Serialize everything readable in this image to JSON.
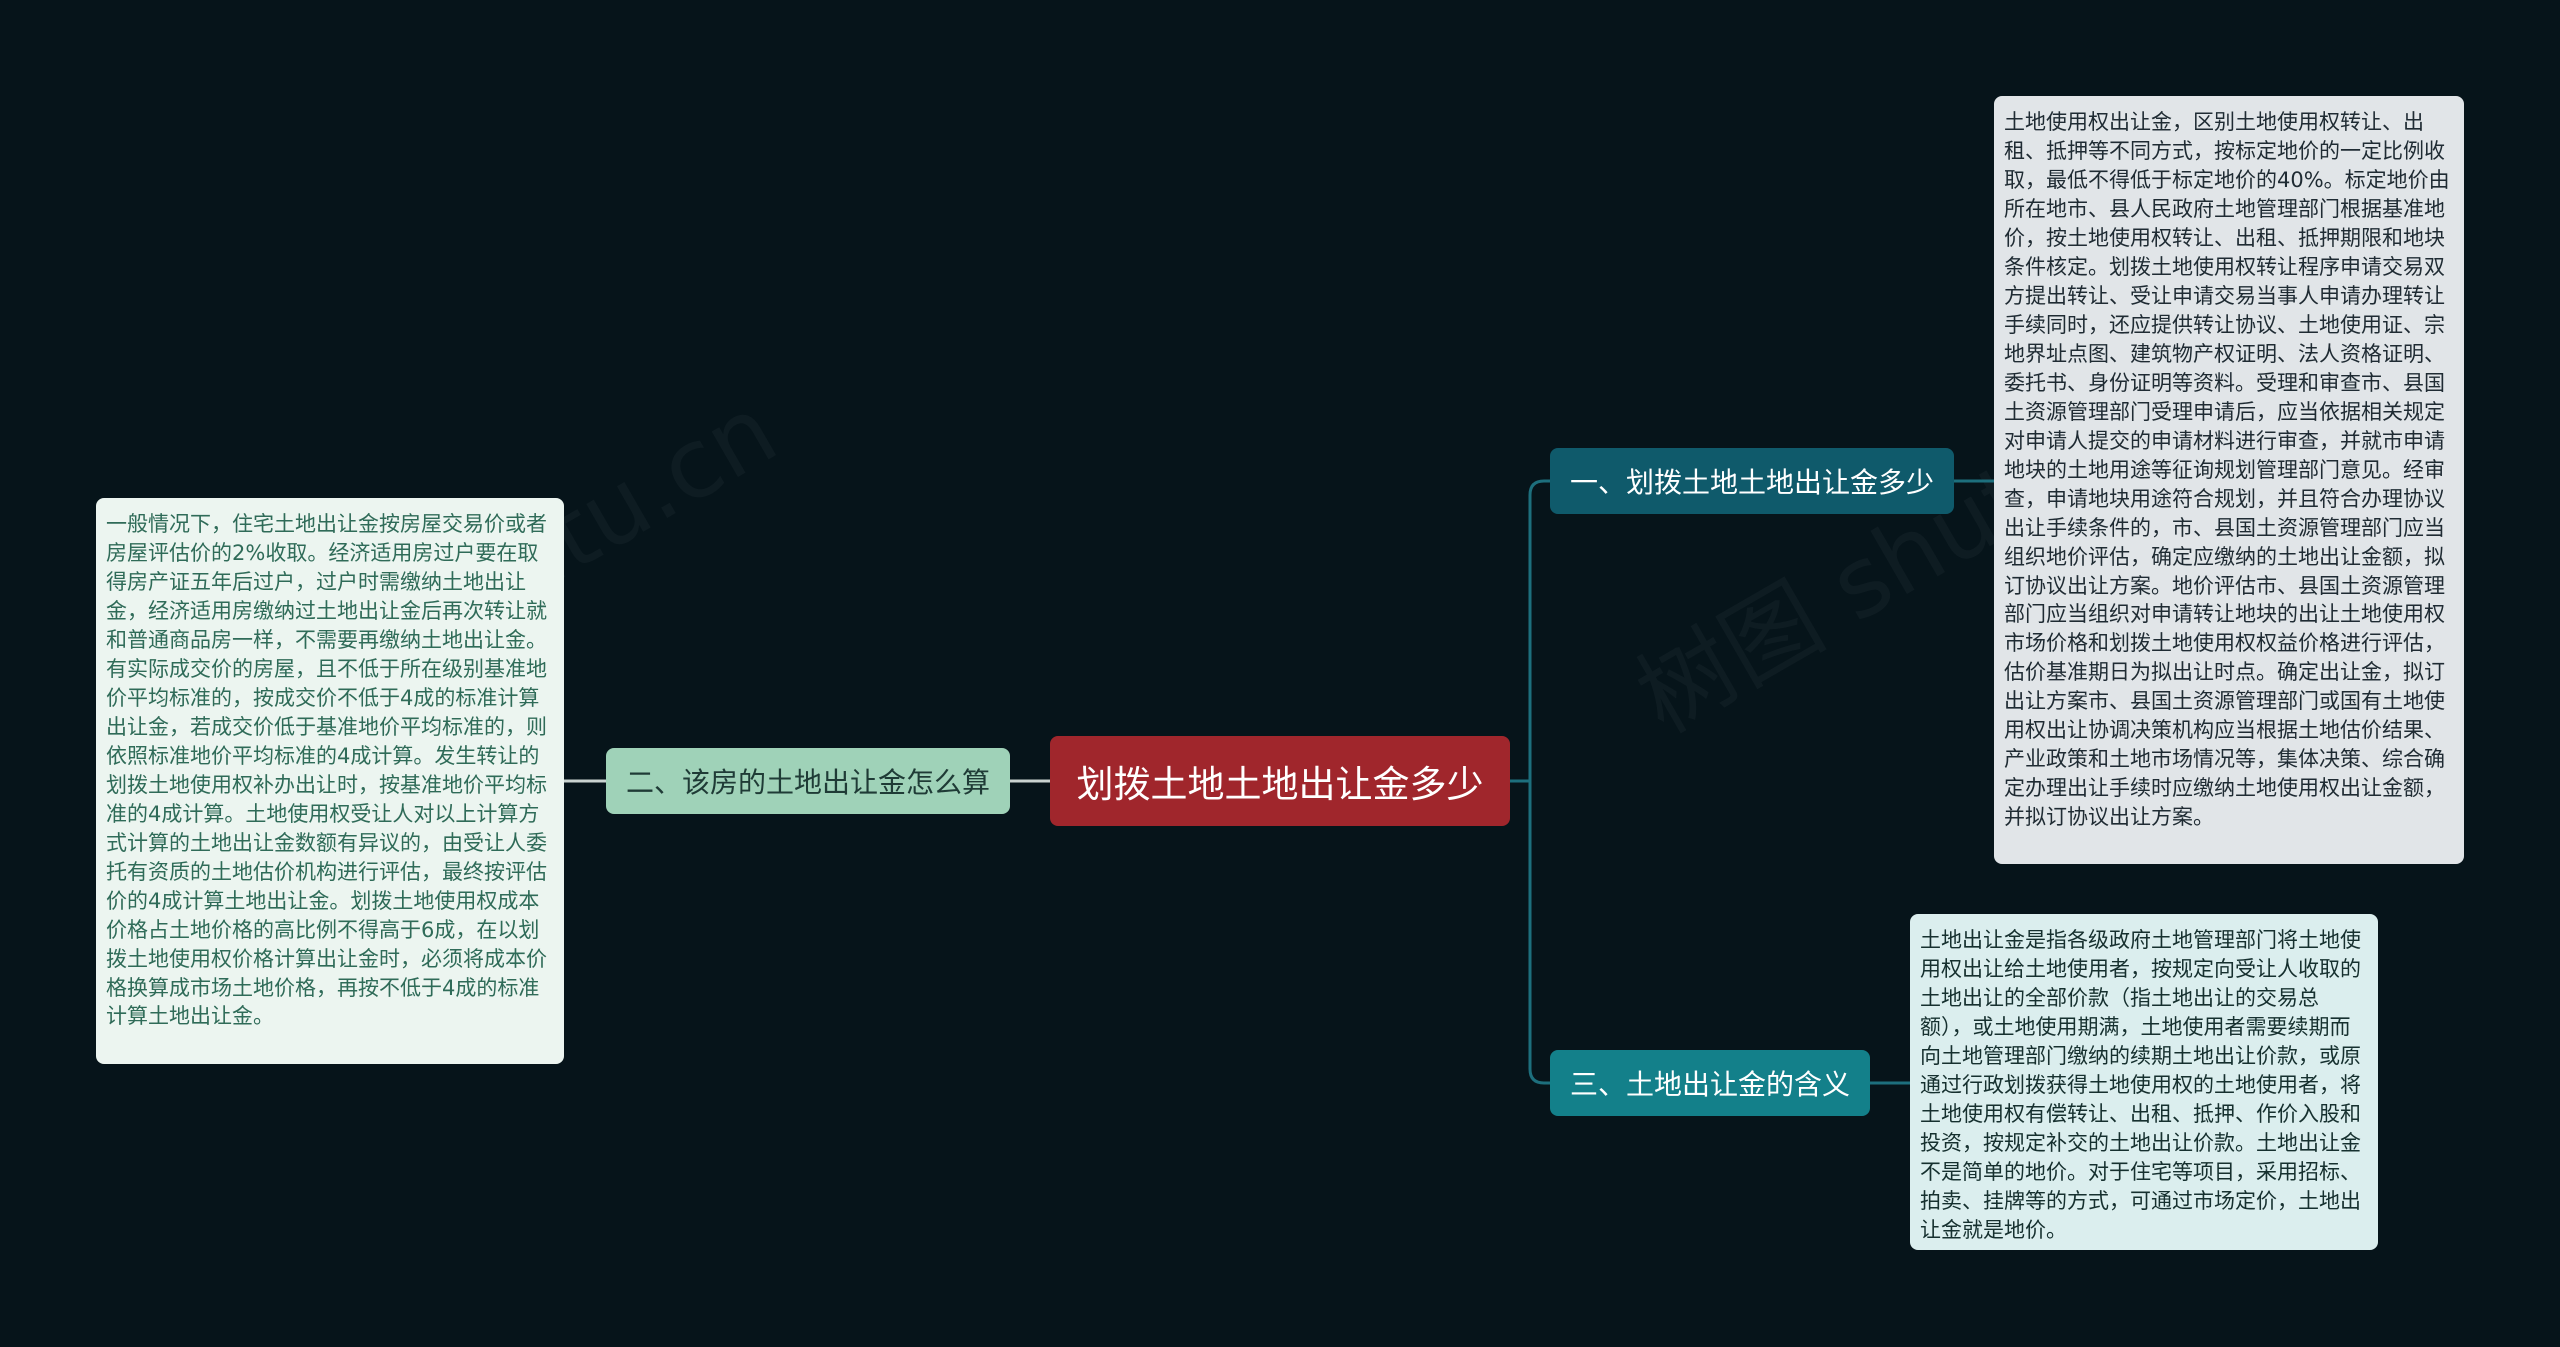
{
  "root": {
    "label": "划拨土地土地出让金多少"
  },
  "branches": [
    {
      "label": "一、划拨土地土地出让金多少"
    },
    {
      "label": "二、该房的土地出让金怎么算"
    },
    {
      "label": "三、土地出让金的含义"
    }
  ],
  "notes": [
    {
      "text": "土地使用权出让金，区别土地使用权转让、出租、抵押等不同方式，按标定地价的一定比例收取，最低不得低于标定地价的40%。标定地价由所在地市、县人民政府土地管理部门根据基准地价，按土地使用权转让、出租、抵押期限和地块条件核定。划拨土地使用权转让程序申请交易双方提出转让、受让申请交易当事人申请办理转让手续同时，还应提供转让协议、土地使用证、宗地界址点图、建筑物产权证明、法人资格证明、委托书、身份证明等资料。受理和审查市、县国土资源管理部门受理申请后，应当依据相关规定对申请人提交的申请材料进行审查，并就市申请地块的土地用途等征询规划管理部门意见。经审查，申请地块用途符合规划，并且符合办理协议出让手续条件的，市、县国土资源管理部门应当组织地价评估，确定应缴纳的土地出让金额，拟订协议出让方案。地价评估市、县国土资源管理部门应当组织对申请转让地块的出让土地使用权市场价格和划拨土地使用权权益价格进行评估，估价基准期日为拟出让时点。确定出让金，拟订出让方案市、县国土资源管理部门或国有土地使用权出让协调决策机构应当根据土地估价结果、产业政策和土地市场情况等，集体决策、综合确定办理出让手续时应缴纳土地使用权出让金额，并拟订协议出让方案。"
    },
    {
      "text": "一般情况下，住宅土地出让金按房屋交易价或者房屋评估价的2%收取。经济适用房过户要在取得房产证五年后过户，过户时需缴纳土地出让金，经济适用房缴纳过土地出让金后再次转让就和普通商品房一样，不需要再缴纳土地出让金。有实际成交价的房屋，且不低于所在级别基准地价平均标准的，按成交价不低于4成的标准计算出让金，若成交价低于基准地价平均标准的，则依照标准地价平均标准的4成计算。发生转让的划拨土地使用权补办出让时，按基准地价平均标准的4成计算。土地使用权受让人对以上计算方式计算的土地出让金数额有异议的，由受让人委托有资质的土地估价机构进行评估，最终按评估价的4成计算土地出让金。划拨土地使用权成本价格占土地价格的高比例不得高于6成，在以划拨土地使用权价格计算出让金时，必须将成本价格换算成市场土地价格，再按不低于4成的标准计算土地出让金。"
    },
    {
      "text": "土地出让金是指各级政府土地管理部门将土地使用权出让给土地使用者，按规定向受让人收取的土地出让的全部价款（指土地出让的交易总额），或土地使用期满，土地使用者需要续期而向土地管理部门缴纳的续期土地出让价款，或原通过行政划拨获得土地使用权的土地使用者，将土地使用权有偿转让、出租、抵押、作价入股和投资，按规定补交的土地出让价款。土地出让金不是简单的地价。对于住宅等项目，采用招标、拍卖、挂牌等的方式，可通过市场定价，土地出让金就是地价。"
    }
  ],
  "colors": {
    "background": "#06141a",
    "root": "#a0262c",
    "branch_1": "#0f5a6b",
    "branch_2": "#9fd2b8",
    "branch_3": "#13808a",
    "connector_right": "#1d6f7d",
    "connector_left": "#c9d3d0"
  }
}
